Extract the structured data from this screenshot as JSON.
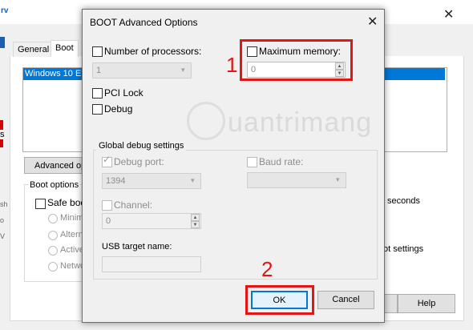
{
  "background_window": {
    "title_initial": "rv",
    "close_glyph": "✕",
    "tabs": [
      {
        "label": "General"
      },
      {
        "label": "Boot"
      }
    ],
    "os_list": {
      "items": [
        "Windows 10 Er"
      ]
    },
    "advanced_button": "Advanced op",
    "boot_options": {
      "label": "Boot options",
      "safe_boot_label": "Safe boo",
      "radios": [
        "Minima",
        "Altern",
        "Active",
        "Netwo"
      ]
    },
    "right_texts": {
      "seconds": "seconds",
      "settings": "ot settings"
    },
    "help_button": "Help",
    "left_edge": {
      "s": "s",
      "marks": [
        "sh",
        "o",
        "V"
      ]
    }
  },
  "dialog": {
    "title": "BOOT Advanced Options",
    "close_glyph": "✕",
    "number_of_processors": {
      "label": "Number of processors:",
      "value": "1",
      "checked": false
    },
    "maximum_memory": {
      "label": "Maximum memory:",
      "value": "0",
      "checked": false
    },
    "pci_lock": {
      "label": "PCI Lock",
      "checked": false
    },
    "debug": {
      "label": "Debug",
      "checked": false
    },
    "global_debug_settings": {
      "label": "Global debug settings",
      "debug_port": {
        "label": "Debug port:",
        "value": "1394",
        "checked": true
      },
      "baud_rate": {
        "label": "Baud rate:",
        "value": ""
      },
      "channel": {
        "label": "Channel:",
        "value": "0"
      },
      "usb_target_name": {
        "label": "USB target name:",
        "value": ""
      }
    },
    "ok_button": "OK",
    "cancel_button": "Cancel"
  },
  "annotations": {
    "marker_1": "1",
    "marker_2": "2",
    "color": "#e31616"
  },
  "watermark": {
    "text": "uantrimang"
  },
  "icons": {
    "dropdown": "▾",
    "spin_up": "▲",
    "spin_down": "▼",
    "check": "✓"
  },
  "colors": {
    "accent": "#0078d7",
    "annotation_red": "#e31616",
    "dialog_bg": "#f0f0f0"
  }
}
